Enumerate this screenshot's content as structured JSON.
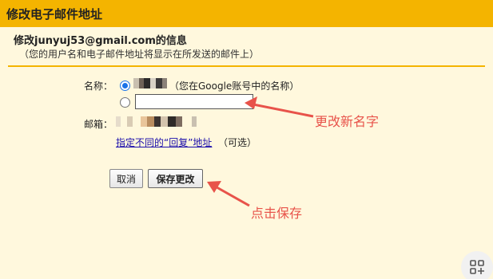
{
  "window": {
    "title": "修改电子邮件地址"
  },
  "form": {
    "heading": "修改junyuj53@gmail.com的信息",
    "subheading": "（您的用户名和电子邮件地址将显示在所发送的邮件上）",
    "name_label": "名称：",
    "google_name_note": "（您在Google账号中的名称）",
    "custom_name_value": "",
    "email_label": "邮箱：",
    "reply_link": "指定不同的“回复”地址",
    "optional_note": "（可选）",
    "cancel_label": "取消",
    "save_label": "保存更改"
  },
  "annotations": {
    "change_name": "更改新名字",
    "click_save": "点击保存"
  },
  "colors": {
    "titlebar": "#f4b400",
    "panel": "#fff8dd",
    "annotation": "#e8534a",
    "link": "#1a0dab"
  },
  "icons": {
    "corner": "grid-plus-icon"
  }
}
